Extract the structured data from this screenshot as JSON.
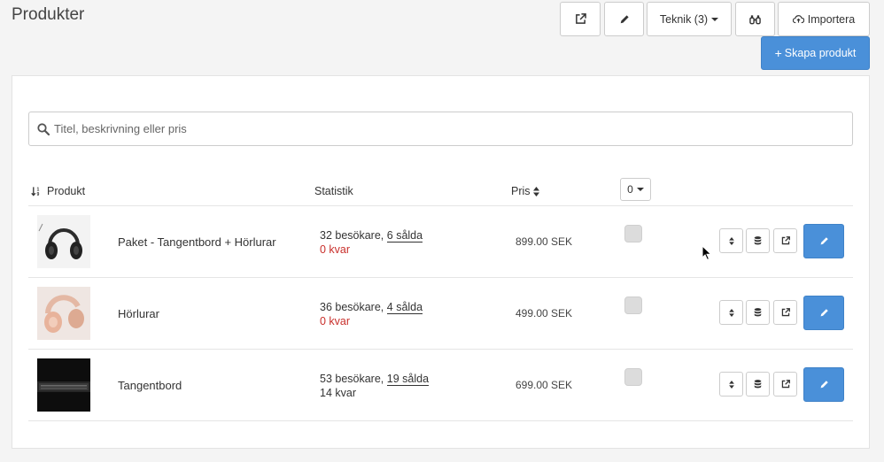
{
  "page": {
    "title": "Produkter"
  },
  "toolbar": {
    "tech_label": "Teknik (3)",
    "import_label": "Importera",
    "create_label": "Skapa produkt"
  },
  "search": {
    "placeholder": "Titel, beskrivning eller pris"
  },
  "table": {
    "headers": {
      "product": "Produkt",
      "stats": "Statistik",
      "price": "Pris",
      "count": "0"
    },
    "rows": [
      {
        "name": "Paket - Tangentbord + Hörlurar",
        "visitors": "32 besökare,",
        "sold": "6 sålda",
        "left": "0 kvar",
        "left_status": "out",
        "price": "899.00 SEK",
        "image": "headphones-black"
      },
      {
        "name": "Hörlurar",
        "visitors": "36 besökare,",
        "sold": "4 sålda",
        "left": "0 kvar",
        "left_status": "out",
        "price": "499.00 SEK",
        "image": "headphones-pink"
      },
      {
        "name": "Tangentbord",
        "visitors": "53 besökare,",
        "sold": "19 sålda",
        "left": "14 kvar",
        "left_status": "in",
        "price": "699.00 SEK",
        "image": "keyboard-dark"
      }
    ]
  },
  "colors": {
    "primary": "#4a90d9",
    "danger": "#c9302c"
  },
  "icons": {
    "toolbar": [
      "external-link-icon",
      "pencil-icon",
      "binoculars-icon",
      "cloud-upload-icon",
      "plus-icon"
    ],
    "row_actions": [
      "sort-icon",
      "database-icon",
      "external-link-icon",
      "pencil-icon"
    ]
  }
}
